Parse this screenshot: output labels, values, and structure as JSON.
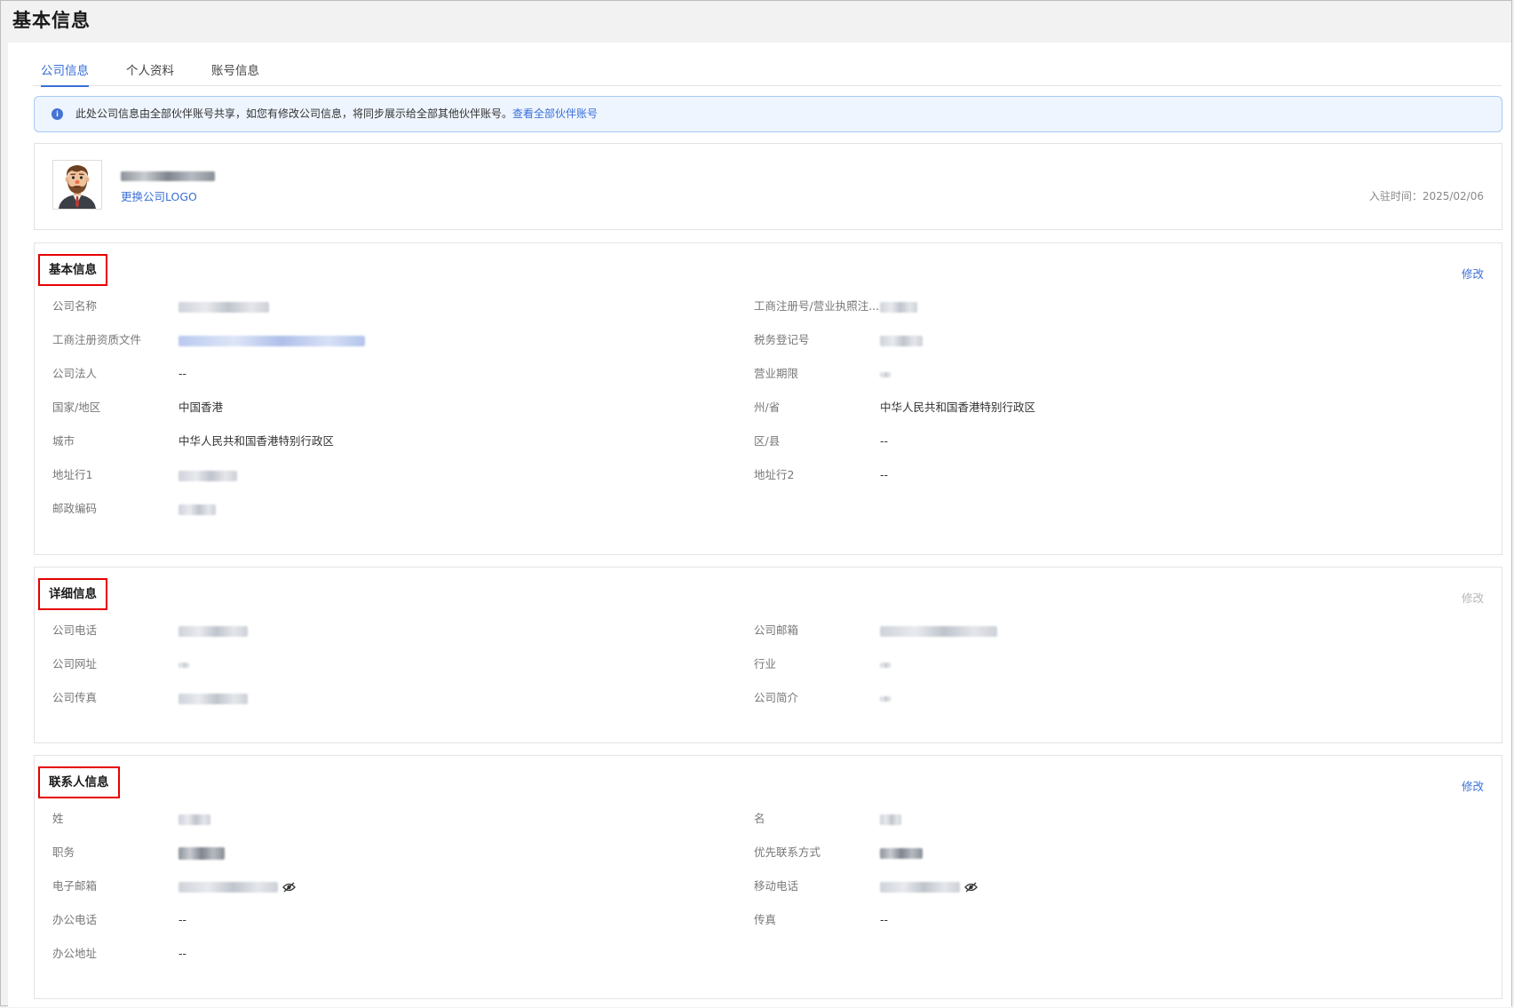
{
  "page": {
    "title": "基本信息"
  },
  "tabs": [
    {
      "label": "公司信息",
      "active": true
    },
    {
      "label": "个人资料",
      "active": false
    },
    {
      "label": "账号信息",
      "active": false
    }
  ],
  "notice": {
    "icon": "info-icon",
    "text": "此处公司信息由全部伙伴账号共享，如您有修改公司信息，将同步展示给全部其他伙伴账号。",
    "link": "查看全部伙伴账号"
  },
  "company": {
    "change_logo": "更换公司LOGO",
    "join_time": "入驻时间：2025/02/06"
  },
  "basic": {
    "title": "基本信息",
    "edit": "修改",
    "fields": {
      "company_name": {
        "label": "公司名称"
      },
      "reg_no": {
        "label": "工商注册号/营业执照注..."
      },
      "reg_file": {
        "label": "工商注册资质文件"
      },
      "tax_no": {
        "label": "税务登记号"
      },
      "legal_person": {
        "label": "公司法人",
        "value": "--"
      },
      "business_term": {
        "label": "营业期限"
      },
      "country": {
        "label": "国家/地区",
        "value": "中国香港"
      },
      "province": {
        "label": "州/省",
        "value": "中华人民共和国香港特别行政区"
      },
      "city": {
        "label": "城市",
        "value": "中华人民共和国香港特别行政区"
      },
      "district": {
        "label": "区/县",
        "value": "--"
      },
      "address1": {
        "label": "地址行1"
      },
      "address2": {
        "label": "地址行2",
        "value": "--"
      },
      "postcode": {
        "label": "邮政编码"
      }
    }
  },
  "detail": {
    "title": "详细信息",
    "edit": "修改",
    "fields": {
      "phone": {
        "label": "公司电话"
      },
      "email": {
        "label": "公司邮箱"
      },
      "website": {
        "label": "公司网址"
      },
      "industry": {
        "label": "行业"
      },
      "fax": {
        "label": "公司传真"
      },
      "intro": {
        "label": "公司简介"
      }
    }
  },
  "contact": {
    "title": "联系人信息",
    "edit": "修改",
    "fields": {
      "last_name": {
        "label": "姓"
      },
      "first_name": {
        "label": "名"
      },
      "position": {
        "label": "职务"
      },
      "preferred_contact": {
        "label": "优先联系方式"
      },
      "email": {
        "label": "电子邮箱",
        "icon": "eye-slash-icon"
      },
      "mobile": {
        "label": "移动电话",
        "icon": "eye-slash-icon"
      },
      "office_phone": {
        "label": "办公电话",
        "value": "--"
      },
      "fax": {
        "label": "传真",
        "value": "--"
      },
      "office_address": {
        "label": "办公地址",
        "value": "--"
      }
    }
  },
  "colors": {
    "accent": "#3a6fd8",
    "highlight_border": "#e60000",
    "notice_bg": "#eef5ff"
  }
}
